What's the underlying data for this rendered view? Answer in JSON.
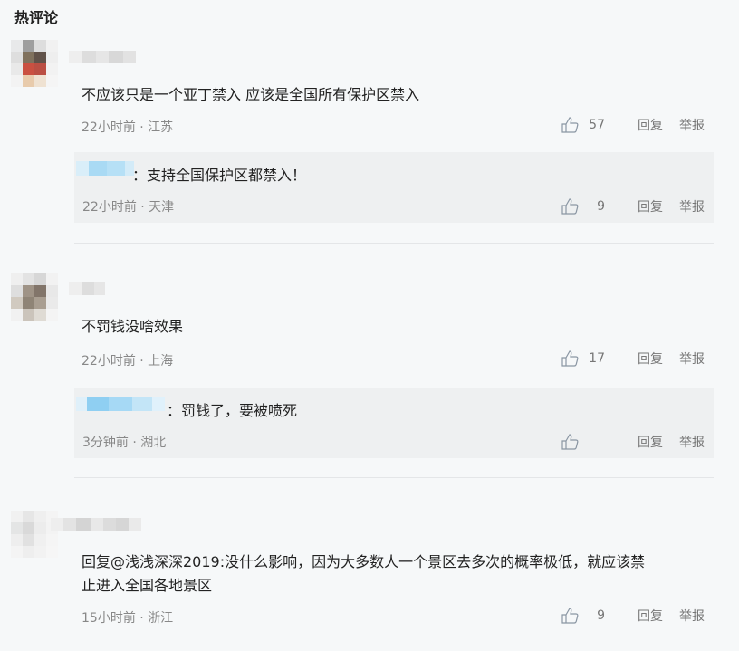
{
  "header": {
    "title": "热评论"
  },
  "comments": [
    {
      "content": "不应该只是一个亚丁禁入 应该是全国所有保护区禁入",
      "meta": "22小时前 · 江苏",
      "likes": "57",
      "reply_label": "回复",
      "report_label": "举报",
      "reply": {
        "text": "：支持全国保护区都禁入！",
        "meta": "22小时前 · 天津",
        "likes": "9",
        "reply_label": "回复",
        "report_label": "举报"
      }
    },
    {
      "content": "不罚钱没啥效果",
      "meta": "22小时前 · 上海",
      "likes": "17",
      "reply_label": "回复",
      "report_label": "举报",
      "reply": {
        "text": "：罚钱了，要被喷死",
        "meta": "3分钟前 · 湖北",
        "likes": "",
        "reply_label": "回复",
        "report_label": "举报"
      }
    },
    {
      "content_line1": "回复@浅浅深深2019:没什么影响，因为大多数人一个景区去多次的概率极低，就应该禁",
      "content_line2": "止进入全国各地景区",
      "meta": "15小时前 · 浙江",
      "likes": "9",
      "reply_label": "回复",
      "report_label": "举报"
    }
  ],
  "icons": {
    "like": "thumbs-up-icon",
    "avatar": "blurred-avatar"
  },
  "colors": {
    "accent_blur_blue": "#9fd4f2",
    "meta_gray": "#888888",
    "reply_bg": "#eef0f1"
  }
}
